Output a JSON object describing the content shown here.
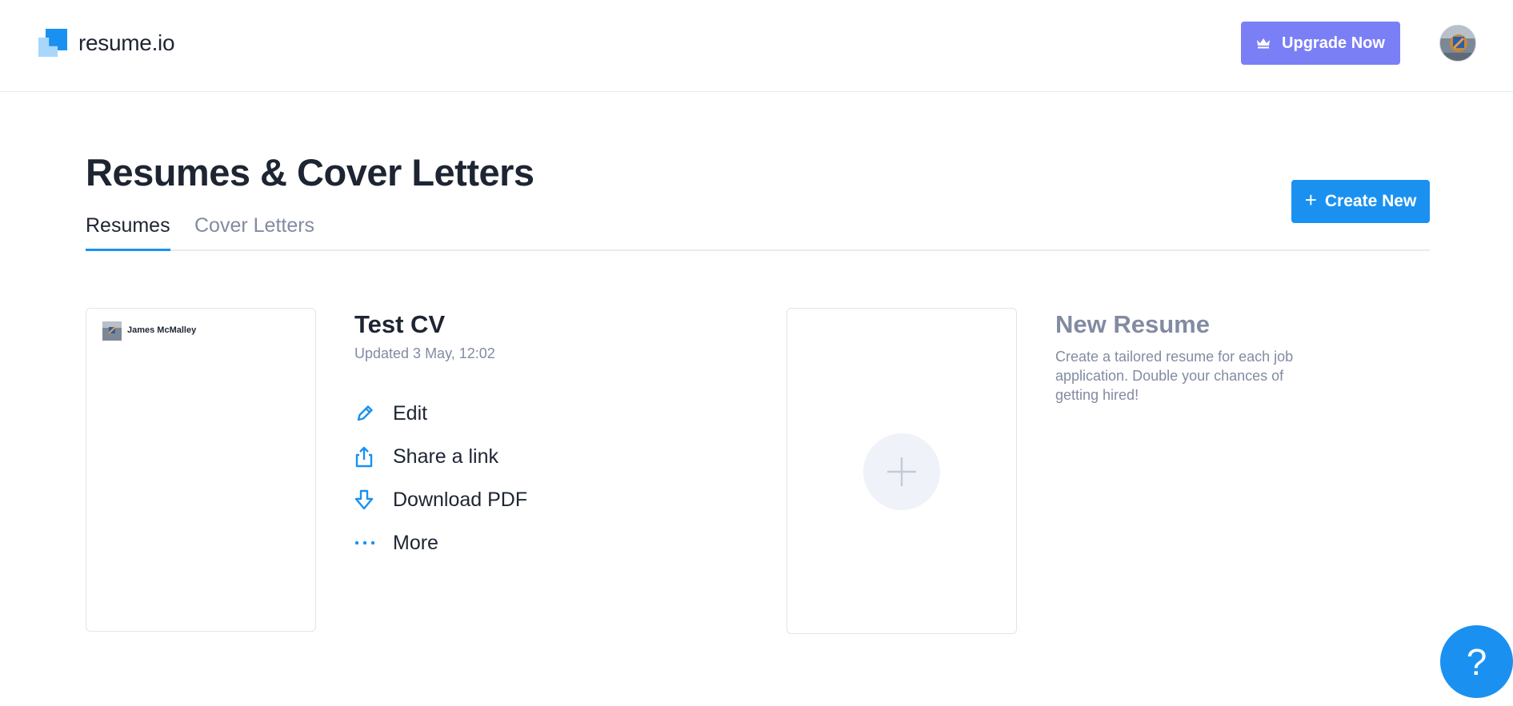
{
  "header": {
    "logo_text": "resume.io",
    "upgrade_label": "Upgrade Now",
    "upgrade_icon": "crown-icon",
    "avatar_icon": "user-avatar"
  },
  "page": {
    "title": "Resumes & Cover Letters",
    "create_label": "Create New",
    "create_icon": "plus-icon"
  },
  "tabs": [
    {
      "label": "Resumes",
      "active": true
    },
    {
      "label": "Cover Letters",
      "active": false
    }
  ],
  "resume": {
    "preview_name": "James McMalley",
    "title": "Test CV",
    "updated": "Updated 3 May, 12:02",
    "actions": [
      {
        "label": "Edit",
        "icon": "pencil-icon"
      },
      {
        "label": "Share a link",
        "icon": "share-icon"
      },
      {
        "label": "Download PDF",
        "icon": "download-icon"
      },
      {
        "label": "More",
        "icon": "more-icon"
      }
    ]
  },
  "new_resume": {
    "title": "New Resume",
    "description": "Create a tailored resume for each job application. Double your chances of getting hired!",
    "icon": "plus-icon"
  },
  "help": {
    "label": "?",
    "icon": "question-icon"
  },
  "colors": {
    "accent": "#1a91f0",
    "upgrade": "#7b7ff5",
    "muted_text": "#828ba2",
    "text": "#1e2532"
  }
}
